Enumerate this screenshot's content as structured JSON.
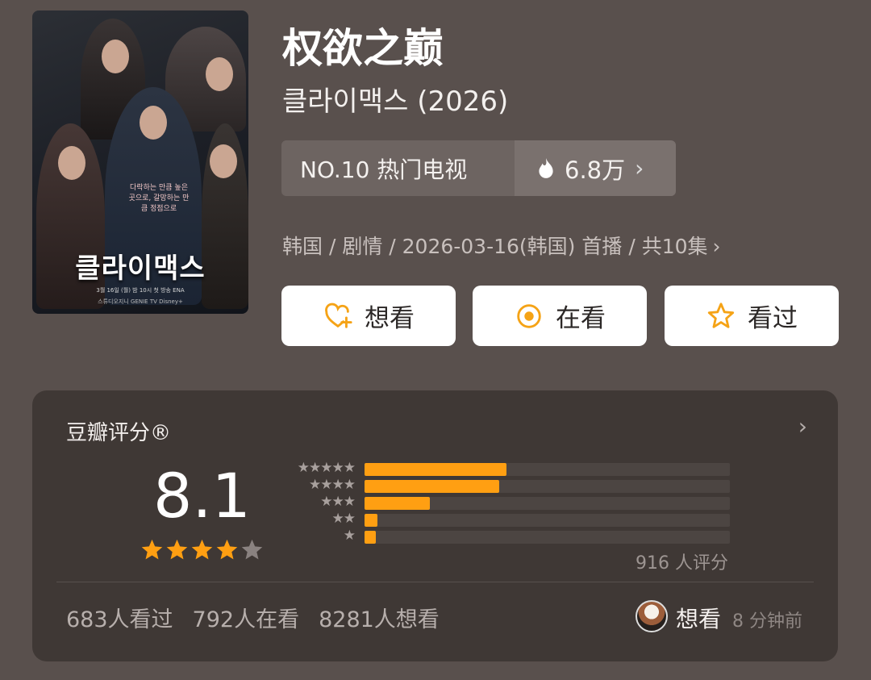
{
  "poster": {
    "title_korean": "클라이맥스",
    "tagline": "다락하는 만큼 높은 곳으로, 갈망하는 만큼 정점으로",
    "footer": "3월 16일 (월) 밤 10시 첫 방송 ENA",
    "brands": "스튜디오지니 GENIE TV Disney+"
  },
  "title": "权欲之巅",
  "subtitle": "클라이맥스 (2026)",
  "rank": {
    "label": "NO.10 热门电视",
    "heat": "6.8万"
  },
  "meta": "韩国 / 剧情 / 2026-03-16(韩国) 首播 / 共10集",
  "buttons": {
    "want": "想看",
    "watching": "在看",
    "watched": "看过"
  },
  "rating": {
    "title": "豆瓣评分®",
    "score": "8.1",
    "stars_filled": 4,
    "stars_total": 5,
    "distribution": [
      {
        "stars": "★★★★★",
        "percent": 38.9
      },
      {
        "stars": "★★★★",
        "percent": 36.8
      },
      {
        "stars": "★★★",
        "percent": 17.9
      },
      {
        "stars": "★★",
        "percent": 3.5
      },
      {
        "stars": "★",
        "percent": 3.0
      }
    ],
    "count": "916 人评分",
    "stats": {
      "watched": "683人看过",
      "watching": "792人在看",
      "want": "8281人想看"
    },
    "recent": {
      "action": "想看",
      "time": "8 分钟前"
    }
  },
  "colors": {
    "accent": "#ff9f12",
    "background": "#59504d",
    "card": "#3f3835"
  }
}
